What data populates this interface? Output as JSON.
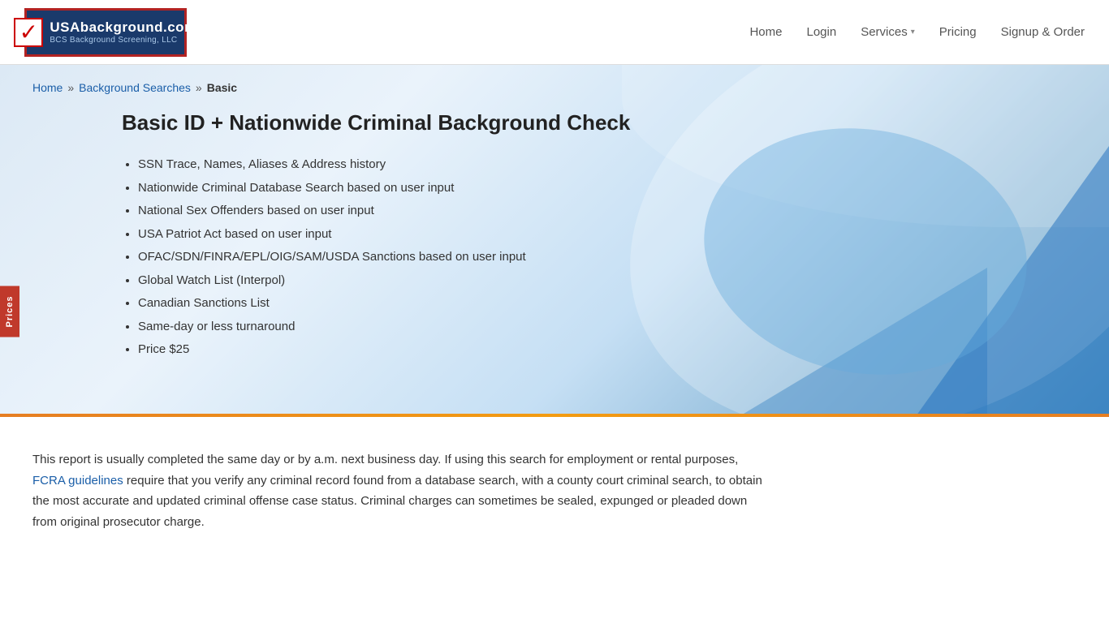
{
  "header": {
    "logo": {
      "main_text": "USAbackground.com",
      "sub_text": "BCS Background Screening, LLC",
      "checkmark": "✓"
    },
    "nav": {
      "items": [
        {
          "label": "Home",
          "id": "home"
        },
        {
          "label": "Login",
          "id": "login"
        },
        {
          "label": "Services",
          "id": "services",
          "has_dropdown": true
        },
        {
          "label": "Pricing",
          "id": "pricing"
        },
        {
          "label": "Signup & Order",
          "id": "signup"
        }
      ]
    }
  },
  "breadcrumb": {
    "home": "Home",
    "separator1": "»",
    "background_searches": "Background Searches",
    "separator2": "»",
    "current": "Basic"
  },
  "hero": {
    "heading": "Basic ID + Nationwide Criminal Background Check",
    "features": [
      "SSN Trace, Names, Aliases & Address history",
      "Nationwide Criminal Database Search based on user input",
      "National Sex Offenders based on user input",
      "USA Patriot Act based on user input",
      "OFAC/SDN/FINRA/EPL/OIG/SAM/USDA Sanctions based on user input",
      "Global Watch List (Interpol)",
      "Canadian Sanctions List",
      "Same-day or less turnaround",
      "Price $25"
    ]
  },
  "prices_tab": {
    "label": "Prices"
  },
  "content": {
    "paragraph": "This report is usually completed the same day or by a.m. next business day. If using this search for employment or rental purposes, ",
    "fcra_link_text": "FCRA guidelines",
    "paragraph_rest": " require that you verify any criminal record found from a database search, with a county court criminal search, to obtain the most accurate and updated criminal offense case status. Criminal charges can sometimes be sealed, expunged or pleaded down from original prosecutor charge."
  }
}
